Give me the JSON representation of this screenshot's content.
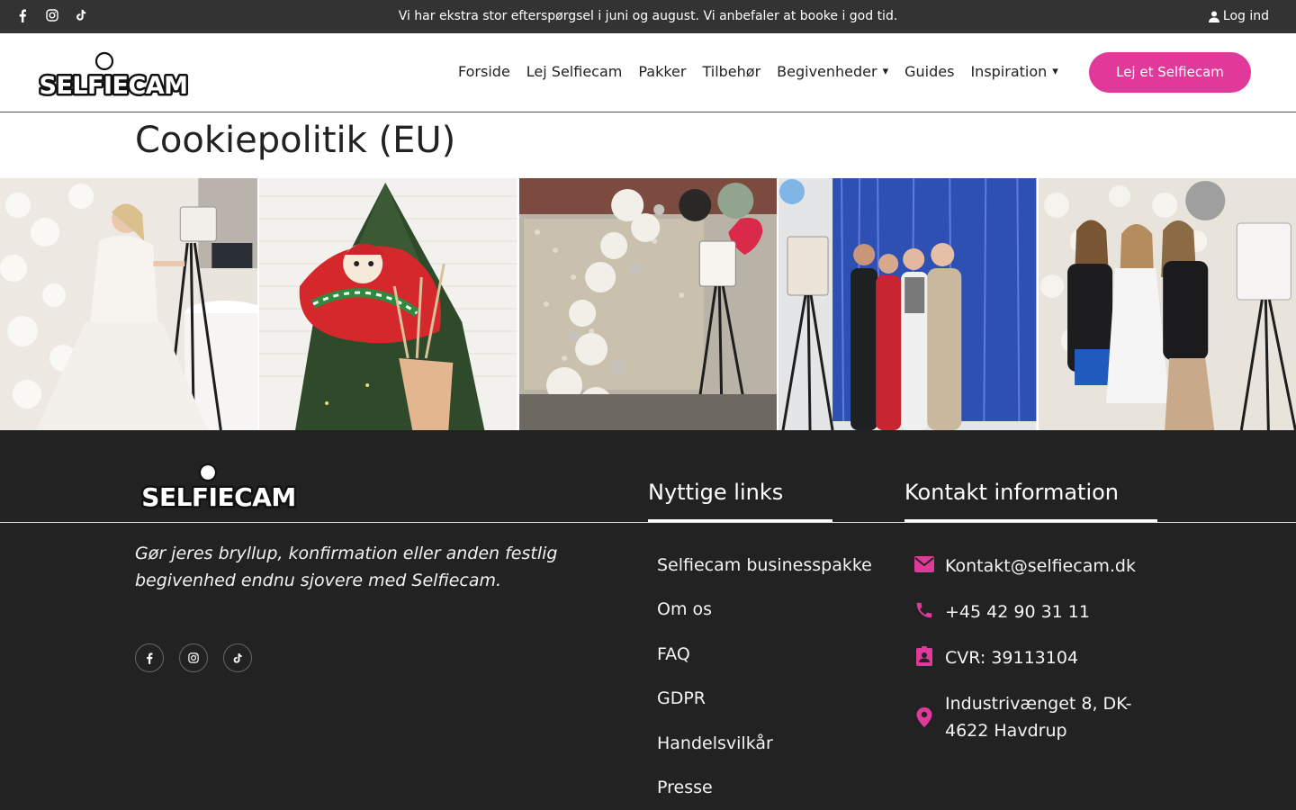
{
  "topbar": {
    "social_icons": [
      "facebook-icon",
      "instagram-icon",
      "tiktok-icon"
    ],
    "notice": "Vi har ekstra stor efterspørgsel i juni og august. Vi anbefaler at booke i god tid.",
    "login_label": "Log ind"
  },
  "header": {
    "logo_text": "SELFIECAM",
    "nav": [
      {
        "label": "Forside"
      },
      {
        "label": "Lej Selfiecam"
      },
      {
        "label": "Pakker"
      },
      {
        "label": "Tilbehør"
      },
      {
        "label": "Begivenheder",
        "has_dropdown": true
      },
      {
        "label": "Guides"
      },
      {
        "label": "Inspiration",
        "has_dropdown": true
      }
    ],
    "cta_label": "Lej et Selfiecam"
  },
  "page": {
    "title": "Cookiepolitik (EU)"
  },
  "gallery": {
    "photos": [
      "wedding-bride-photo",
      "christmas-props-photo",
      "balloon-backdrop-photo",
      "party-group-photo",
      "girls-group-photo"
    ]
  },
  "footer": {
    "logo_text": "SELFIECAM",
    "tagline": "Gør jeres bryllup, konfirmation eller anden festlig begivenhed endnu sjovere med Selfiecam.",
    "social_icons": [
      "facebook-icon",
      "instagram-icon",
      "tiktok-icon"
    ],
    "links_title": "Nyttige links",
    "links": [
      "Selfiecam businesspakke",
      "Om os",
      "FAQ",
      "GDPR",
      "Handelsvilkår",
      "Presse"
    ],
    "contact_title": "Kontakt information",
    "contact": [
      {
        "icon": "mail-icon",
        "text": "Kontakt@selfiecam.dk"
      },
      {
        "icon": "phone-icon",
        "text": "+45 42 90 31 11"
      },
      {
        "icon": "id-badge-icon",
        "text": "CVR: 39113104"
      },
      {
        "icon": "location-pin-icon",
        "text": "Industrivænget 8, DK-4622 Havdrup"
      }
    ]
  },
  "colors": {
    "accent": "#e0399a",
    "topbar_bg": "#333333",
    "footer_bg": "#232222"
  }
}
